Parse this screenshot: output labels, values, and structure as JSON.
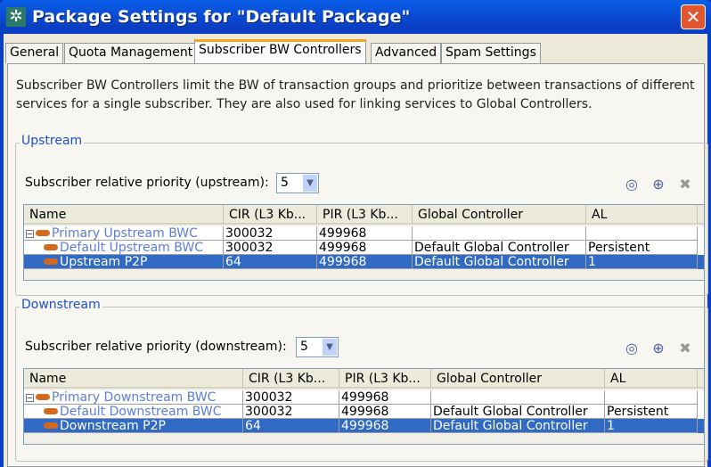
{
  "window": {
    "title": "Package Settings for \"Default Package\"",
    "close": "✕",
    "icon": "✲"
  },
  "tabs": [
    "General",
    "Quota Management",
    "Subscriber BW Controllers",
    "Advanced",
    "Spam Settings"
  ],
  "description": "Subscriber BW Controllers limit the BW of transaction groups and prioritize between transactions of different services for a single subscriber. They are also used for linking services to Global Controllers.",
  "upstream": {
    "title": "Upstream",
    "priority_label": "Subscriber relative priority (upstream):",
    "priority_value": "5",
    "columns": [
      "Name",
      "CIR (L3 Kb...",
      "PIR (L3 Kb...",
      "Global Controller",
      "AL"
    ],
    "rows": [
      [
        "Primary Upstream BWC",
        "300032",
        "499968",
        "",
        ""
      ],
      [
        "Default Upstream BWC",
        "300032",
        "499968",
        "Default Global Controller",
        "Persistent"
      ],
      [
        "Upstream P2P",
        "64",
        "499968",
        "Default Global Controller",
        "1"
      ]
    ]
  },
  "downstream": {
    "title": "Downstream",
    "priority_label": "Subscriber relative priority (downstream):",
    "priority_value": "5",
    "columns": [
      "Name",
      "CIR (L3 Kb...",
      "PIR (L3 Kb...",
      "Global Controller",
      "AL"
    ],
    "rows": [
      [
        "Primary Downstream BWC",
        "300032",
        "499968",
        "",
        ""
      ],
      [
        "Default Downstream BWC",
        "300032",
        "499968",
        "Default Global Controller",
        "Persistent"
      ],
      [
        "Downstream P2P",
        "64",
        "499968",
        "Default Global Controller",
        "1"
      ]
    ]
  }
}
